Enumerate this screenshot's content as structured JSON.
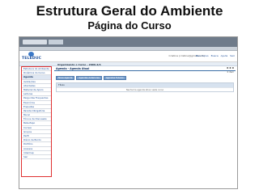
{
  "slide": {
    "title": "Estrutura Geral do Ambiente",
    "subtitle": "Página do Curso"
  },
  "browser": {
    "url": "",
    "tabs": []
  },
  "app": {
    "logo_text": "TELEDUC",
    "user_info": "Cristina (cristina@gmail.com)",
    "header_links": [
      "Meu Curso",
      "Busca",
      "Ajuda",
      "Sair"
    ],
    "course_name": "Organizando o Curso - 2009-2/A"
  },
  "menu": {
    "items": [
      {
        "label": "Estrutura do Ambiente",
        "active": false
      },
      {
        "label": "Dinâmica do Curso",
        "active": false
      },
      {
        "label": "Agenda",
        "active": true
      },
      {
        "label": "Avaliações",
        "active": false
      },
      {
        "label": "Atividades",
        "active": false
      },
      {
        "label": "Material de Apoio",
        "active": false
      },
      {
        "label": "Leituras",
        "active": false
      },
      {
        "label": "Perguntas Frequentes",
        "active": false
      },
      {
        "label": "Exercícios",
        "active": false
      },
      {
        "label": "Enquetes",
        "active": false
      },
      {
        "label": "Parada Obrigatória",
        "active": false
      },
      {
        "label": "Mural",
        "active": false
      },
      {
        "label": "Fóruns de Discussão",
        "active": false
      },
      {
        "label": "Bate-Papo",
        "active": false
      },
      {
        "label": "Correio",
        "active": false
      },
      {
        "label": "Grupos",
        "active": false
      },
      {
        "label": "Perfil",
        "active": false
      },
      {
        "label": "Diário de Bordo",
        "active": false
      },
      {
        "label": "Portfólio",
        "active": false
      },
      {
        "label": "Acessos",
        "active": false
      },
      {
        "label": "Intermap",
        "active": false
      },
      {
        "label": "Sair",
        "active": false
      }
    ]
  },
  "content": {
    "page_title": "Agenda - Agenda Atual",
    "controls": "x x x",
    "right_small": "0 item",
    "actions": [
      "Nova Agenda",
      "Agendas Anteriores",
      "Agendas Futuras"
    ],
    "table_header": "Título",
    "table_empty": "Nenhuma agenda ativa neste curso"
  },
  "colors": {
    "highlight_border": "#e03030",
    "link": "#1d4f9a",
    "button": "#7aa1cf"
  }
}
